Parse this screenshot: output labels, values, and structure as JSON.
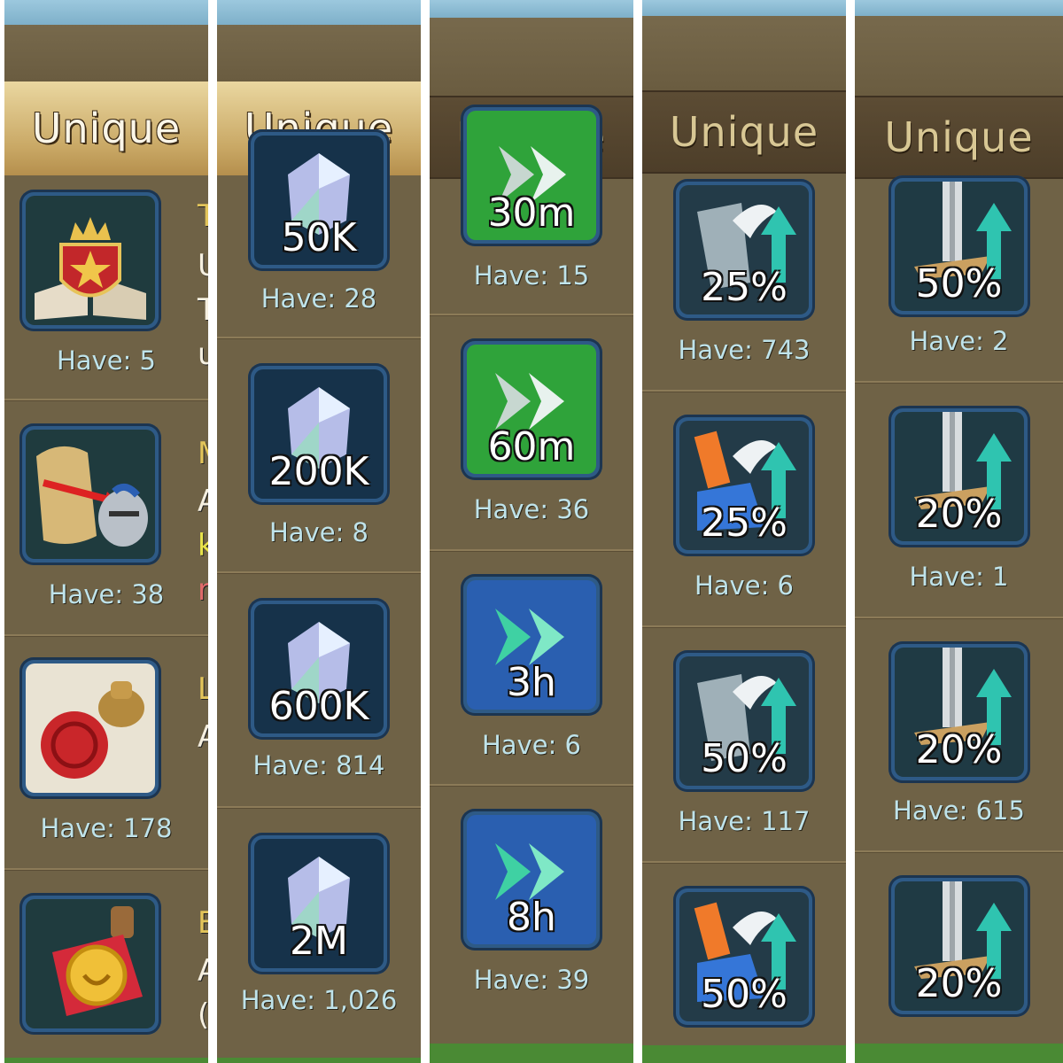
{
  "panels": [
    {
      "header": "Unique",
      "items": [
        {
          "icon": "book-crown-icon",
          "have": "Have: 5",
          "letters": [
            "T",
            "U",
            "T",
            "u"
          ],
          "letter_colors": [
            "#e2c45a",
            "#f5efe0",
            "#f5efe0",
            "#f5efe0"
          ]
        },
        {
          "icon": "scroll-knight-icon",
          "have": "Have: 38",
          "letters": [
            "M",
            "A",
            "k",
            "r"
          ],
          "letter_colors": [
            "#e2c45a",
            "#f5efe0",
            "#e8e34a",
            "#e06a6a"
          ]
        },
        {
          "icon": "wax-seal-stamp-icon",
          "have": "Have: 178",
          "letters": [
            "L",
            "A"
          ],
          "letter_colors": [
            "#e2c45a",
            "#f5efe0"
          ]
        },
        {
          "icon": "golden-stamp-icon",
          "have": "",
          "letters": [
            "E",
            "A",
            "("
          ],
          "letter_colors": [
            "#e2c45a",
            "#f5efe0",
            "#f5efe0"
          ]
        }
      ]
    },
    {
      "header": "Unique",
      "items": [
        {
          "icon": "crystal-icon",
          "amount": "50K",
          "have": "Have: 28"
        },
        {
          "icon": "crystal-icon",
          "amount": "200K",
          "have": "Have: 8"
        },
        {
          "icon": "crystal-icon",
          "amount": "600K",
          "have": "Have: 814"
        },
        {
          "icon": "crystal-icon",
          "amount": "2M",
          "have": "Have: 1,026"
        }
      ]
    },
    {
      "header": "Unique",
      "items": [
        {
          "icon": "speedup-arrows-icon",
          "amount": "30m",
          "have": "Have: 15",
          "bg": "#2fa33a"
        },
        {
          "icon": "speedup-arrows-icon",
          "amount": "60m",
          "have": "Have: 36",
          "bg": "#2fa33a"
        },
        {
          "icon": "speedup-arrows-icon",
          "amount": "3h",
          "have": "Have: 6",
          "bg": "#2a5fb0"
        },
        {
          "icon": "speedup-arrows-icon",
          "amount": "8h",
          "have": "Have: 39",
          "bg": "#2a5fb0"
        }
      ]
    },
    {
      "header": "Unique",
      "items": [
        {
          "icon": "winged-boot-boost-icon",
          "amount": "25%",
          "have": "Have: 743"
        },
        {
          "icon": "winged-sneaker-boost-icon",
          "amount": "25%",
          "have": "Have: 6"
        },
        {
          "icon": "winged-boot-boost-icon",
          "amount": "50%",
          "have": "Have: 117"
        },
        {
          "icon": "winged-sneaker-boost-icon",
          "amount": "50%",
          "have": ""
        }
      ]
    },
    {
      "header": "Unique",
      "items": [
        {
          "icon": "sword-boost-icon",
          "amount": "50%",
          "have": "Have: 2"
        },
        {
          "icon": "sword-boost-icon",
          "amount": "20%",
          "have": "Have: 1"
        },
        {
          "icon": "sword-boost-icon",
          "amount": "20%",
          "have": "Have: 615"
        },
        {
          "icon": "sword-boost-icon",
          "amount": "20%",
          "have": ""
        }
      ]
    }
  ]
}
